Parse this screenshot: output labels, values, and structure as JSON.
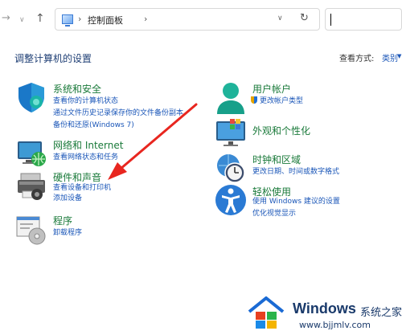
{
  "address_bar": {
    "path": "控制面板",
    "search_value": ""
  },
  "header": {
    "title": "调整计算机的设置",
    "view_by_label": "查看方式:",
    "view_by_value": "类别"
  },
  "categories": {
    "system_security": {
      "title": "系统和安全",
      "links": [
        "查看你的计算机状态",
        "通过文件历史记录保存你的文件备份副本",
        "备份和还原(Windows 7)"
      ]
    },
    "network": {
      "title": "网络和 Internet",
      "links": [
        "查看网络状态和任务"
      ]
    },
    "hardware_sound": {
      "title": "硬件和声音",
      "links": [
        "查看设备和打印机",
        "添加设备"
      ]
    },
    "programs": {
      "title": "程序",
      "links": [
        "卸载程序"
      ]
    },
    "user_accounts": {
      "title": "用户帐户",
      "links": [
        "更改帐户类型"
      ]
    },
    "appearance": {
      "title": "外观和个性化",
      "links": []
    },
    "clock_region": {
      "title": "时钟和区域",
      "links": [
        "更改日期、时间或数字格式"
      ]
    },
    "ease_of_access": {
      "title": "轻松使用",
      "links": [
        "使用 Windows 建议的设置",
        "优化视觉显示"
      ]
    }
  },
  "watermark": {
    "brand": "Windows",
    "brand_cn": "系统之家",
    "url": "www.bjjmlv.com"
  },
  "colors": {
    "category_title": "#1a7a3a",
    "link": "#1a56b8",
    "page_title": "#1f3f75",
    "annotation_arrow": "#e8261f"
  }
}
